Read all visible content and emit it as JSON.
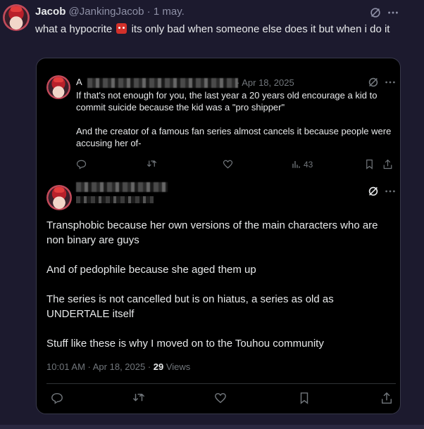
{
  "post": {
    "author_name": "Jacob",
    "handle": "@JankingJacob",
    "separator": "·",
    "date": "1 may.",
    "text_before_emoji": "what a hypocrite",
    "emoji_name": "ogre-emoji",
    "text_after_emoji": "its only bad when someone else does it but when i do it"
  },
  "quoted_tweet": {
    "name_initial": "A",
    "date": "· Apr 18, 2025",
    "paragraphs": [
      "If that's not enough for you, the last year a 20 years old encourage a kid to commit suicide because the kid was a \"pro shipper\"",
      "And the creator of a famous fan series almost cancels it because people were accusing her of-"
    ],
    "views_count": "43"
  },
  "reply_tweet": {
    "paragraphs": [
      "Transphobic because her own versions of the main characters who are non binary are guys",
      "And of pedophile because she aged them up",
      "The series is not cancelled but is on hiatus, a series as old as UNDERTALE itself",
      "Stuff like these is why I moved on to the Touhou community"
    ],
    "time_date": "10:01 AM · Apr 18, 2025 · ",
    "views_number": "29",
    "views_label": " Views"
  },
  "colors": {
    "background": "#1c1a2e",
    "card_background": "#000000",
    "muted_text": "#71767b",
    "primary_text": "#e7e9ea"
  }
}
